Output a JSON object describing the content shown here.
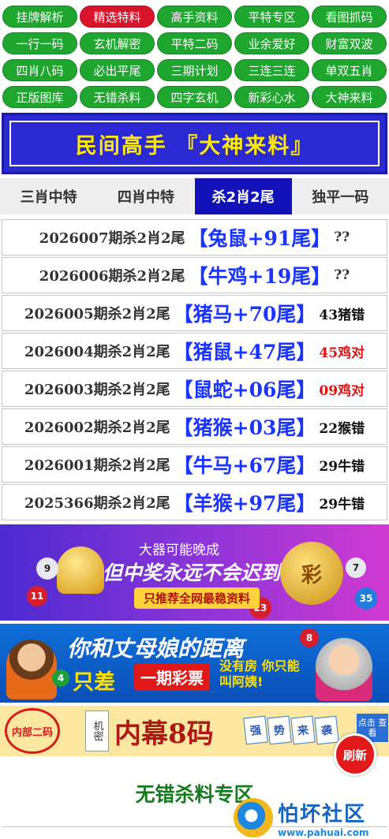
{
  "nav": {
    "items": [
      {
        "label": "挂牌解析",
        "active": false
      },
      {
        "label": "精选特料",
        "active": true
      },
      {
        "label": "高手资料",
        "active": false
      },
      {
        "label": "平特专区",
        "active": false
      },
      {
        "label": "看图抓码",
        "active": false
      },
      {
        "label": "一行一码",
        "active": false
      },
      {
        "label": "玄机解密",
        "active": false
      },
      {
        "label": "平特二码",
        "active": false
      },
      {
        "label": "业余爱好",
        "active": false
      },
      {
        "label": "财富双波",
        "active": false
      },
      {
        "label": "四肖八码",
        "active": false
      },
      {
        "label": "必出平尾",
        "active": false
      },
      {
        "label": "三期计划",
        "active": false
      },
      {
        "label": "三连三连",
        "active": false
      },
      {
        "label": "单双五肖",
        "active": false
      },
      {
        "label": "正版图库",
        "active": false
      },
      {
        "label": "无错杀料",
        "active": false
      },
      {
        "label": "四字玄机",
        "active": false
      },
      {
        "label": "新彩心水",
        "active": false
      },
      {
        "label": "大神来料",
        "active": false
      }
    ]
  },
  "banner": {
    "title": "民间高手 『大神来料』"
  },
  "tabs": [
    {
      "label": "三肖中特",
      "active": false
    },
    {
      "label": "四肖中特",
      "active": false
    },
    {
      "label": "杀2肖2尾",
      "active": true
    },
    {
      "label": "独平一码",
      "active": false
    }
  ],
  "rows": [
    {
      "period": "2026007期杀2肖2尾",
      "pick": "【兔鼠+91尾】",
      "result": "??",
      "status": "pending"
    },
    {
      "period": "2026006期杀2肖2尾",
      "pick": "【牛鸡+19尾】",
      "result": "??",
      "status": "pending"
    },
    {
      "period": "2026005期杀2肖2尾",
      "pick": "【猪马+70尾】",
      "result": "43猪错",
      "status": "miss"
    },
    {
      "period": "2026004期杀2肖2尾",
      "pick": "【猪鼠+47尾】",
      "result": "45鸡对",
      "status": "hit"
    },
    {
      "period": "2026003期杀2肖2尾",
      "pick": "【鼠蛇+06尾】",
      "result": "09鸡对",
      "status": "hit"
    },
    {
      "period": "2026002期杀2肖2尾",
      "pick": "【猪猴+03尾】",
      "result": "22猴错",
      "status": "miss"
    },
    {
      "period": "2026001期杀2肖2尾",
      "pick": "【牛马+67尾】",
      "result": "29牛错",
      "status": "miss"
    },
    {
      "period": "2025366期杀2肖2尾",
      "pick": "【羊猴+97尾】",
      "result": "29牛错",
      "status": "miss"
    }
  ],
  "ads": {
    "ad1": {
      "line1": "大器可能晚成",
      "line2": "但中奖永远不会迟到",
      "line3": "只推荐全网最稳资料",
      "coin": "彩"
    },
    "ad2": {
      "line1": "你和丈母娘的距离",
      "line2": "只差",
      "badge": "一期彩票",
      "line3": "没有房 你只能叫阿姨!"
    },
    "ad3": {
      "seal": "内部二码",
      "tag": "机密",
      "main": "内幕8码",
      "strong": [
        "强",
        "势",
        "来",
        "袭"
      ],
      "click": "点击 查看"
    }
  },
  "refresh_label": "刷新",
  "section_title": "无错杀料专区",
  "watermark": {
    "name": "怕坏社区",
    "url": "www.pahuai.com"
  },
  "colors": {
    "nav_green": "#1ea62f",
    "nav_active": "#d8142a",
    "banner_blue": "#2a29d4",
    "banner_text": "#ffea00",
    "pick_blue": "#1a35ff",
    "hit_red": "#e01010",
    "section_green": "#137c1d"
  }
}
